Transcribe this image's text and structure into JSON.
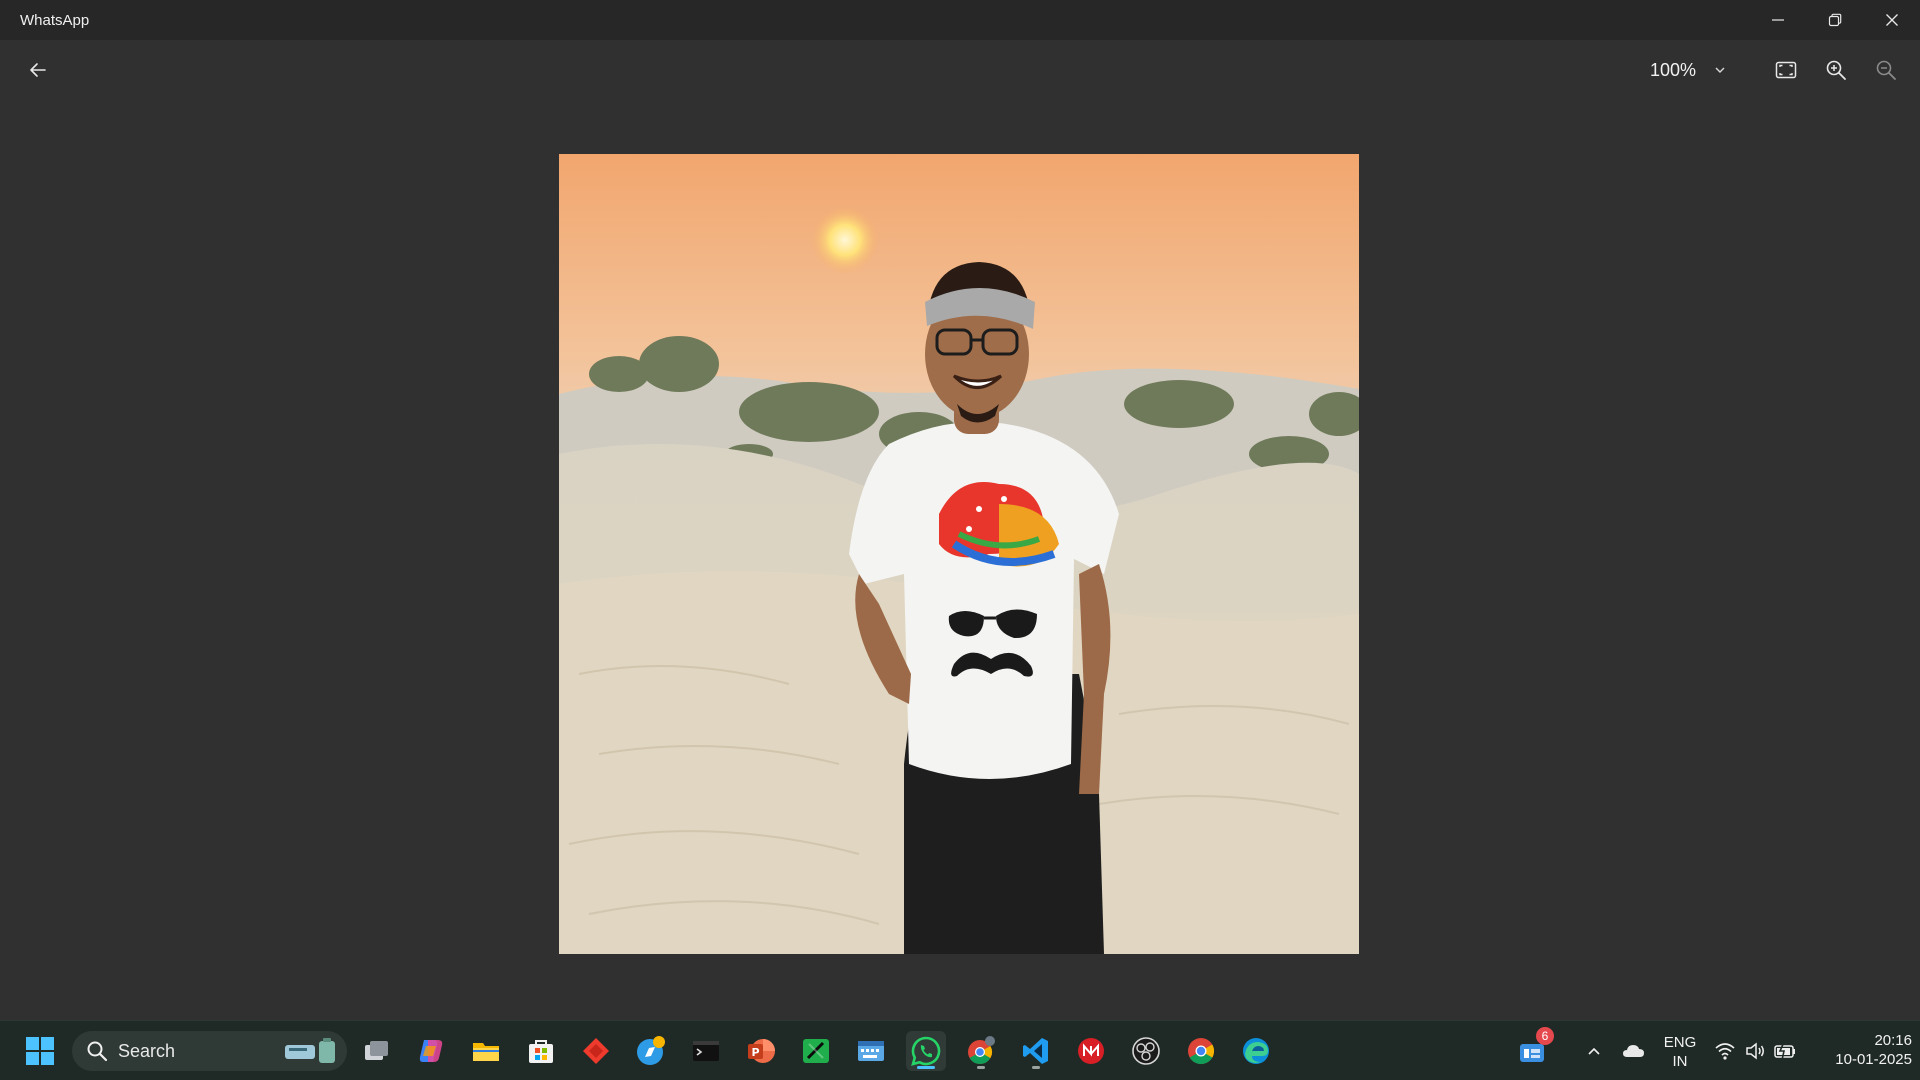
{
  "window": {
    "title": "WhatsApp",
    "controls": {
      "minimize": "minimize-icon",
      "restore": "restore-icon",
      "close": "close-icon"
    }
  },
  "viewer": {
    "zoom_value": "100%",
    "tools": [
      "back-arrow-icon",
      "fit-to-screen-icon",
      "zoom-in-icon",
      "zoom-out-icon"
    ]
  },
  "photo": {
    "subject": "man-in-desert-at-sunset",
    "tshirt_print": "turban-sunglasses-moustache"
  },
  "taskbar": {
    "search_label": "Search",
    "apps": [
      "task-view-icon",
      "copilot-icon",
      "file-explorer-icon",
      "microsoft-store-icon",
      "anydesk-icon",
      "safari-style-icon",
      "terminal-icon",
      "powerpoint-icon",
      "spreadsheet-icon",
      "keyboard-app-icon",
      "whatsapp-icon",
      "chrome-profile-icon",
      "vscode-icon",
      "antivirus-icon",
      "obs-icon",
      "chrome-icon",
      "edge-icon"
    ],
    "widget_badge": "6",
    "language": {
      "line1": "ENG",
      "line2": "IN"
    },
    "clock": {
      "time": "20:16",
      "date": "10-01-2025"
    }
  },
  "colors": {
    "window_bg": "#303030",
    "titlebar_bg": "#272727",
    "taskbar_bg": "#1f2a26",
    "whatsapp_green": "#25d366",
    "accent_blue": "#4cc2ff"
  }
}
